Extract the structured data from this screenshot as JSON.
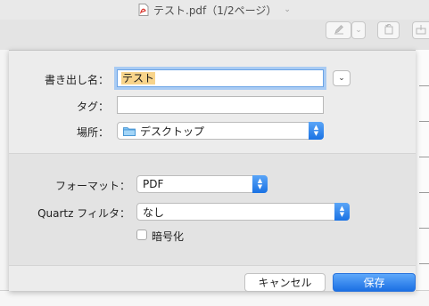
{
  "window": {
    "title": "テスト.pdf（1/2ページ）",
    "title_chevron": "⌄"
  },
  "toolbar": {
    "markup_icon": "pen-icon",
    "markup_chevron": "⌄",
    "rotate_icon": "rotate-icon",
    "share_icon": "share-icon"
  },
  "save_sheet": {
    "save_as_label": "書き出し名：",
    "save_as_value": "テスト",
    "disclosure_glyph": "⌄",
    "tags_label": "タグ：",
    "tags_value": "",
    "where_label": "場所：",
    "where_value": "デスクトップ",
    "format_label": "フォーマット：",
    "format_value": "PDF",
    "quartz_label": "Quartz フィルタ：",
    "quartz_value": "なし",
    "encrypt_label": "暗号化",
    "encrypt_checked": false,
    "cancel_label": "キャンセル",
    "save_label": "保存"
  },
  "colors": {
    "accent": "#1b6fe3",
    "selection": "#f8d48b",
    "focus_ring": "#a9cbf3"
  }
}
